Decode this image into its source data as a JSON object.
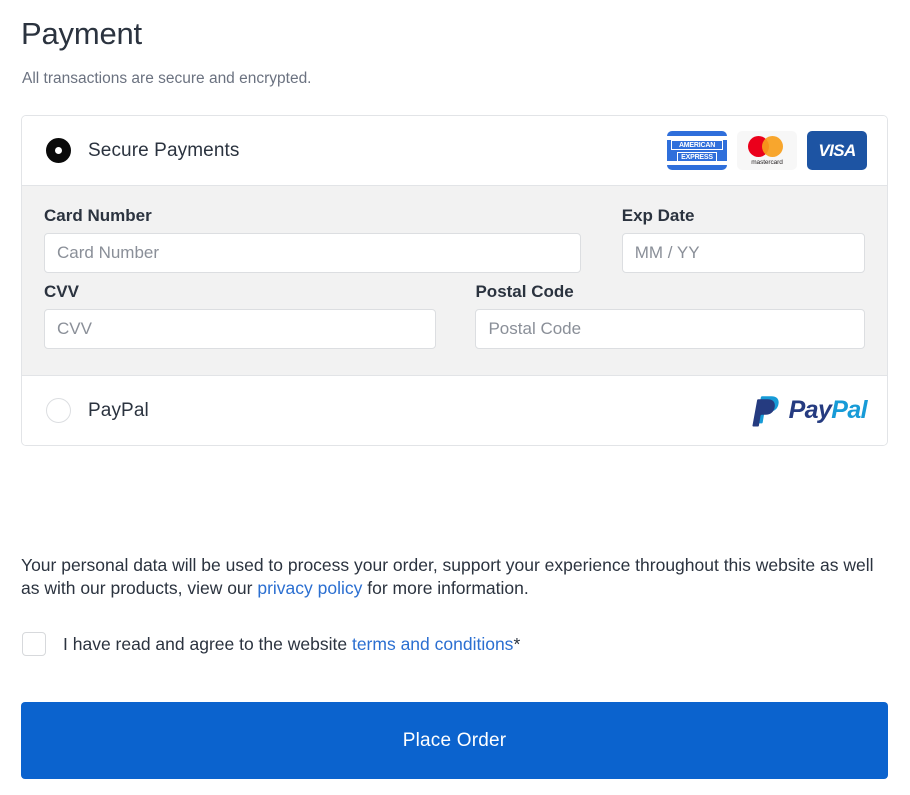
{
  "header": {
    "title": "Payment",
    "subtitle": "All transactions are secure and encrypted."
  },
  "payment_panel": {
    "methods": [
      {
        "id": "secure-payments",
        "label": "Secure Payments",
        "selected": true,
        "radio_icon": "radio-selected-icon",
        "brands": [
          {
            "name": "american-express-logo",
            "line1": "AMERICAN",
            "line2": "EXPRESS",
            "color": "#2f6fdb"
          },
          {
            "name": "mastercard-logo",
            "text": "mastercard",
            "color_left": "#eb001b",
            "color_right": "#f79e1b"
          },
          {
            "name": "visa-logo",
            "text": "VISA",
            "color": "#1d54a3"
          }
        ]
      },
      {
        "id": "paypal",
        "label": "PayPal",
        "selected": false,
        "radio_icon": "radio-unselected-icon",
        "logo": {
          "name": "paypal-logo",
          "word_dark": "Pay",
          "word_light": "Pal",
          "color_dark": "#253b80",
          "color_light": "#179bd7"
        }
      }
    ],
    "card_fields": [
      {
        "id": "card-number",
        "label": "Card Number",
        "placeholder": "Card Number",
        "value": ""
      },
      {
        "id": "exp-date",
        "label": "Exp Date",
        "placeholder": "MM / YY",
        "value": ""
      },
      {
        "id": "cvv",
        "label": "CVV",
        "placeholder": "CVV",
        "value": ""
      },
      {
        "id": "postal-code",
        "label": "Postal Code",
        "placeholder": "Postal Code",
        "value": ""
      }
    ]
  },
  "privacy": {
    "part1": "Your personal data will be used to process your order, support your experience throughout this website as well as with our products, view our ",
    "link": "privacy policy",
    "part2": " for more information."
  },
  "terms": {
    "checked": false,
    "text_before": "I have read and agree to the website ",
    "link": "terms and conditions",
    "required_mark": "*"
  },
  "actions": {
    "place_order_label": "Place Order",
    "place_order_color": "#0b63ce"
  }
}
